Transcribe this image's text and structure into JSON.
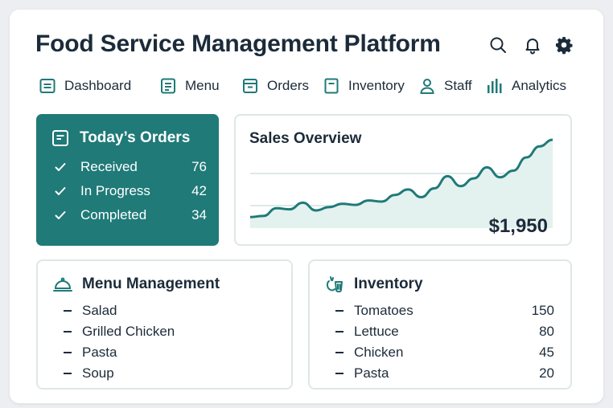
{
  "app": {
    "title": "Food Service Management Platform"
  },
  "header_icons": [
    "search-icon",
    "bell-icon",
    "gear-icon"
  ],
  "nav": {
    "items": [
      {
        "label": "Dashboard",
        "icon": "dashboard-icon"
      },
      {
        "label": "Menu",
        "icon": "menu-icon"
      },
      {
        "label": "Orders",
        "icon": "orders-icon"
      },
      {
        "label": "Inventory",
        "icon": "inventory-icon"
      },
      {
        "label": "Staff",
        "icon": "staff-icon"
      },
      {
        "label": "Analytics",
        "icon": "analytics-icon"
      }
    ]
  },
  "orders": {
    "title": "Today’s Orders",
    "rows": [
      {
        "label": "Received",
        "count": "76"
      },
      {
        "label": "In Progress",
        "count": "42"
      },
      {
        "label": "Completed",
        "count": "34"
      }
    ]
  },
  "sales": {
    "title": "Sales Overview",
    "total": "$1,950",
    "trend": [
      10,
      11,
      18,
      17,
      23,
      16,
      19,
      22,
      21,
      25,
      24,
      30,
      35,
      28,
      36,
      47,
      38,
      45,
      55,
      46,
      52,
      64,
      74,
      80
    ]
  },
  "menu_panel": {
    "title": "Menu Management",
    "items": [
      "Salad",
      "Grilled Chicken",
      "Pasta",
      "Soup"
    ]
  },
  "inventory_panel": {
    "title": "Inventory",
    "items": [
      {
        "name": "Tomatoes",
        "qty": "150"
      },
      {
        "name": "Lettuce",
        "qty": "80"
      },
      {
        "name": "Chicken",
        "qty": "45"
      },
      {
        "name": "Pasta",
        "qty": "20"
      }
    ]
  },
  "colors": {
    "accent": "#1f7a78",
    "text": "#1c2b3a",
    "chart_fill": "#e3f1ef"
  }
}
